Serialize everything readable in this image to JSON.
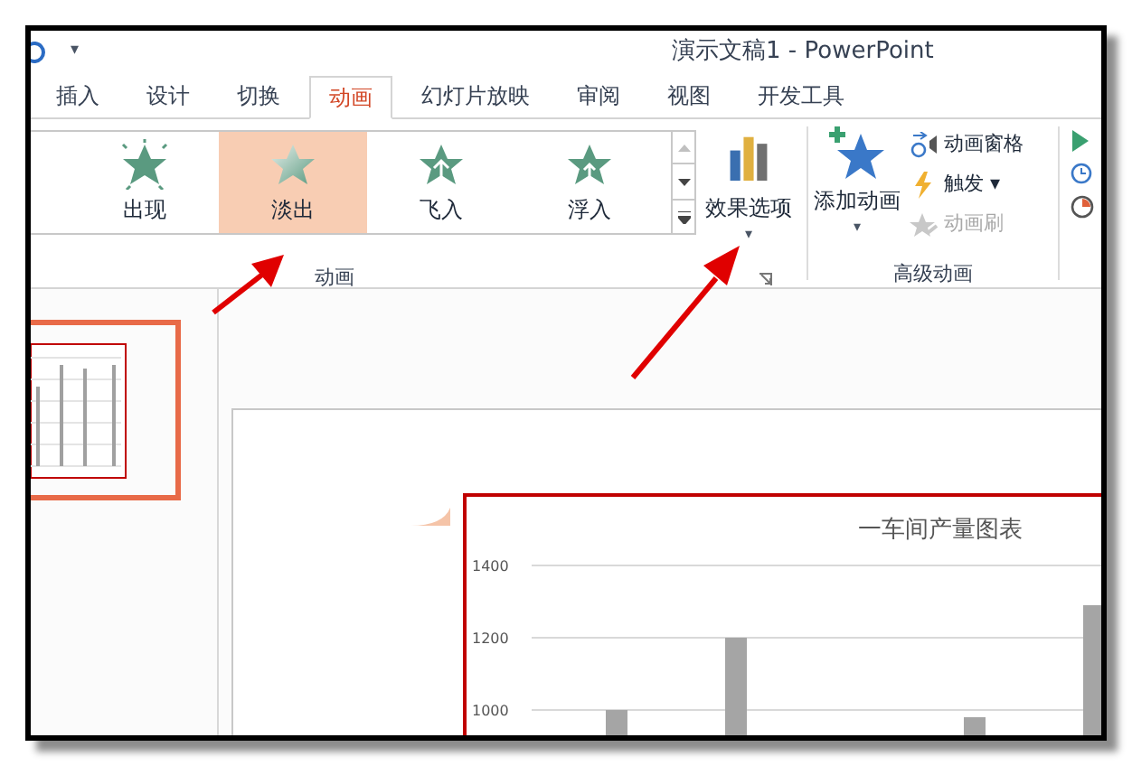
{
  "window": {
    "title": "演示文稿1 - PowerPoint",
    "qat_menu": "▾"
  },
  "tabs": [
    {
      "label": "插入",
      "selected": false
    },
    {
      "label": "设计",
      "selected": false
    },
    {
      "label": "切换",
      "selected": false
    },
    {
      "label": "动画",
      "selected": true
    },
    {
      "label": "幻灯片放映",
      "selected": false
    },
    {
      "label": "审阅",
      "selected": false
    },
    {
      "label": "视图",
      "selected": false
    },
    {
      "label": "开发工具",
      "selected": false
    }
  ],
  "animation_gallery": [
    {
      "label": "出现",
      "kind": "burst",
      "selected": false
    },
    {
      "label": "淡出",
      "kind": "fade",
      "selected": true
    },
    {
      "label": "飞入",
      "kind": "fly",
      "selected": false
    },
    {
      "label": "浮入",
      "kind": "float",
      "selected": false
    }
  ],
  "effect_options": {
    "label": "效果选项",
    "caret": "▾"
  },
  "animation_group_label": "动画",
  "add_animation": {
    "label": "添加动画",
    "caret": "▾"
  },
  "advanced_items": [
    {
      "label": "动画窗格",
      "kind": "pane",
      "disabled": false
    },
    {
      "label": "触发",
      "kind": "trigger",
      "caret": "▾",
      "disabled": false
    },
    {
      "label": "动画刷",
      "kind": "painter",
      "disabled": true
    }
  ],
  "advanced_group_label": "高级动画",
  "slide": {
    "chart_data": {
      "type": "bar",
      "title": "一车间产量图表",
      "ylim": [
        0,
        1400
      ],
      "yticks": [
        1000,
        1200,
        1400
      ],
      "values": [
        1000,
        1200,
        null,
        980,
        1290
      ]
    }
  }
}
